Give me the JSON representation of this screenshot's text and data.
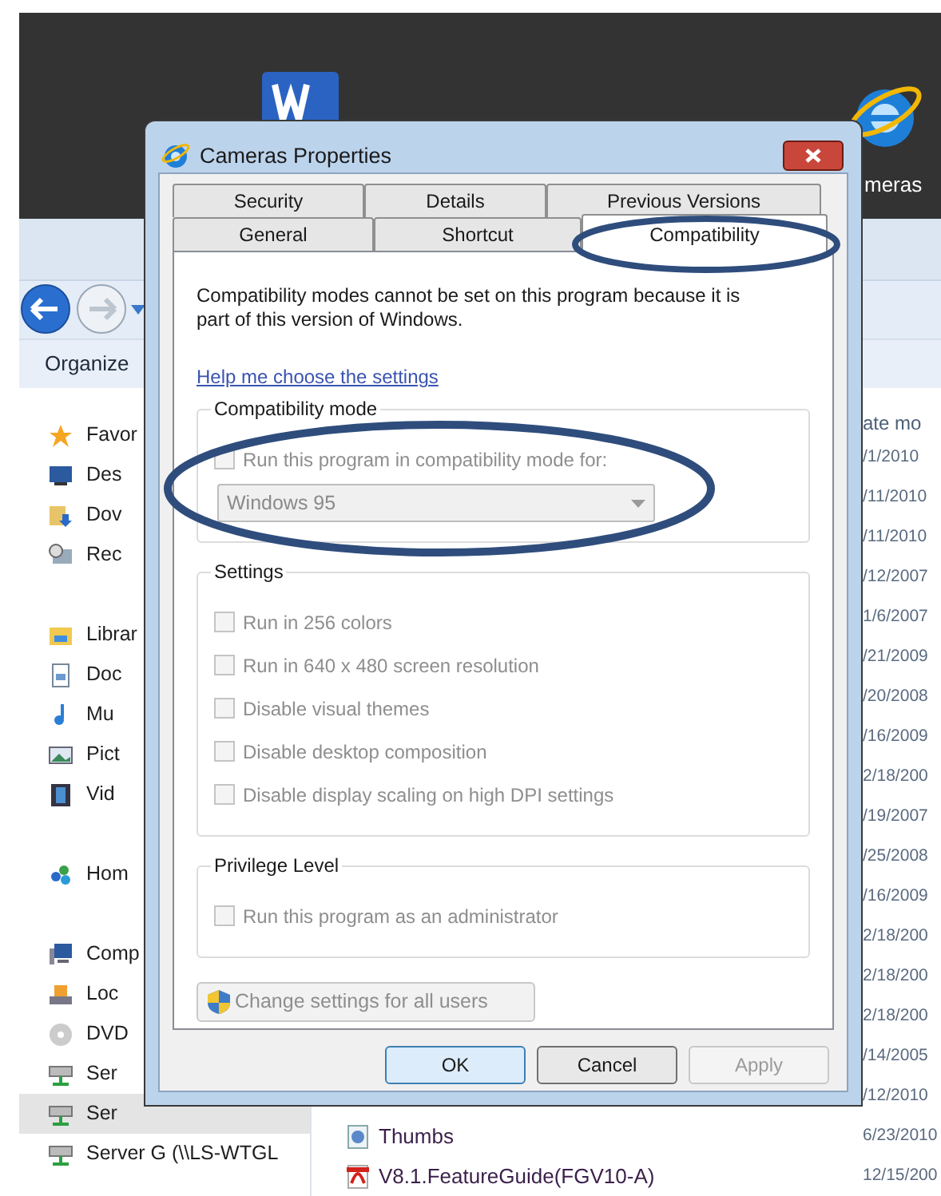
{
  "desktop": {
    "icon_label": "meras"
  },
  "explorer": {
    "toolbar": {
      "organize": "Organize"
    },
    "nav_groups": [
      {
        "label": "Favor",
        "selected": false,
        "children": [
          {
            "label": "Des",
            "selected": false
          },
          {
            "label": "Dov",
            "selected": false
          },
          {
            "label": "Rec",
            "selected": false
          }
        ]
      },
      {
        "label": "Librar",
        "selected": false,
        "children": [
          {
            "label": "Doc",
            "selected": false
          },
          {
            "label": "Mu",
            "selected": false
          },
          {
            "label": "Pict",
            "selected": false
          },
          {
            "label": "Vid",
            "selected": false
          }
        ]
      },
      {
        "label": "Hom",
        "selected": false
      },
      {
        "label": "Comp",
        "selected": false,
        "children": [
          {
            "label": "Loc",
            "selected": false
          },
          {
            "label": "DVD",
            "selected": false
          },
          {
            "label": "Ser",
            "selected": false
          },
          {
            "label": "Ser",
            "selected": true
          },
          {
            "label": "Server G (\\\\LS-WTGL",
            "selected": false
          }
        ]
      }
    ],
    "date_header": "ate mo",
    "rows": [
      {
        "date_modified": "/1/2010"
      },
      {
        "date_modified": "/11/2010"
      },
      {
        "date_modified": "/11/2010"
      },
      {
        "date_modified": "/12/2007"
      },
      {
        "date_modified": "1/6/2007"
      },
      {
        "date_modified": "/21/2009"
      },
      {
        "date_modified": "/20/2008"
      },
      {
        "date_modified": "/16/2009"
      },
      {
        "date_modified": "2/18/200"
      },
      {
        "date_modified": "/19/2007"
      },
      {
        "date_modified": "/25/2008"
      },
      {
        "date_modified": "/16/2009"
      },
      {
        "date_modified": "2/18/200"
      },
      {
        "date_modified": "2/18/200"
      },
      {
        "date_modified": "2/18/200"
      },
      {
        "date_modified": "/14/2005"
      },
      {
        "date_modified": "/12/2010"
      },
      {
        "name": "Thumbs",
        "kind": "shortcut",
        "date_modified": "6/23/2010"
      },
      {
        "name": "V8.1.FeatureGuide(FGV10-A)",
        "kind": "pdf",
        "date_modified": "12/15/200"
      }
    ]
  },
  "dialog": {
    "title": "Cameras Properties",
    "tab_rows": [
      [
        {
          "label": "Security",
          "selected": false
        },
        {
          "label": "Details",
          "selected": false
        },
        {
          "label": "Previous Versions",
          "selected": false
        }
      ],
      [
        {
          "label": "General",
          "selected": false
        },
        {
          "label": "Shortcut",
          "selected": false
        },
        {
          "label": "Compatibility",
          "selected": true
        }
      ]
    ],
    "message": "Compatibility modes cannot be set on this program because it is part of this version of Windows.",
    "help_link": "Help me choose the settings",
    "groups": [
      {
        "title": "Compatibility mode",
        "checkboxes": [
          {
            "label": "Run this program in compatibility mode for:",
            "checked": false,
            "disabled": true
          }
        ],
        "select": {
          "value": "Windows 95",
          "disabled": true
        }
      },
      {
        "title": "Settings",
        "checkboxes": [
          {
            "label": "Run in 256 colors",
            "checked": false,
            "disabled": true
          },
          {
            "label": "Run in 640 x 480 screen resolution",
            "checked": false,
            "disabled": true
          },
          {
            "label": "Disable visual themes",
            "checked": false,
            "disabled": true
          },
          {
            "label": "Disable desktop composition",
            "checked": false,
            "disabled": true
          },
          {
            "label": "Disable display scaling on high DPI settings",
            "checked": false,
            "disabled": true
          }
        ]
      },
      {
        "title": "Privilege Level",
        "checkboxes": [
          {
            "label": "Run this program as an administrator",
            "checked": false,
            "disabled": true
          }
        ]
      }
    ],
    "change_button": {
      "label": "Change settings for all users",
      "disabled": true
    },
    "buttons": [
      {
        "label": "OK",
        "default": true,
        "disabled": false
      },
      {
        "label": "Cancel",
        "default": false,
        "disabled": false
      },
      {
        "label": "Apply",
        "default": false,
        "disabled": true
      }
    ]
  }
}
